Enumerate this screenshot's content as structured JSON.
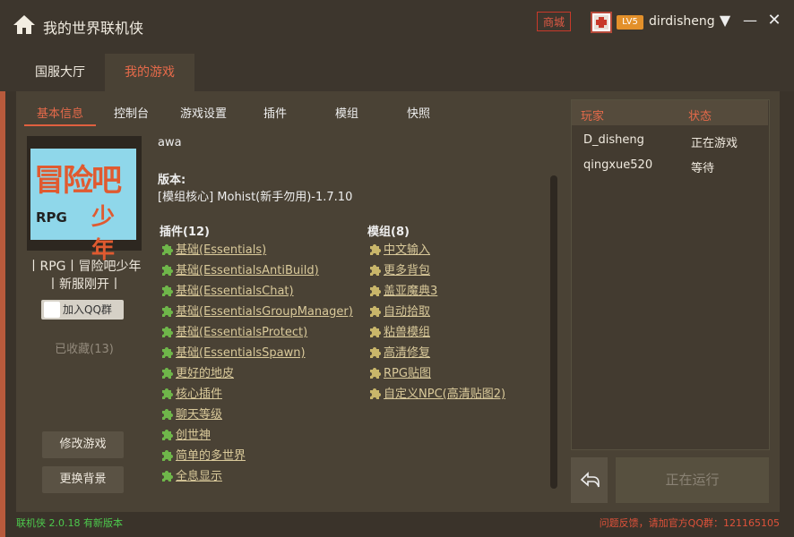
{
  "window": {
    "title": "我的世界联机侠",
    "shop": "商城",
    "level": "LV5",
    "username": "dirdisheng"
  },
  "main_tabs": [
    {
      "label": "国服大厅"
    },
    {
      "label": "我的游戏"
    }
  ],
  "sub_tabs": [
    {
      "label": "基本信息"
    },
    {
      "label": "控制台"
    },
    {
      "label": "游戏设置"
    },
    {
      "label": "插件"
    },
    {
      "label": "模组"
    },
    {
      "label": "快照"
    }
  ],
  "server": {
    "logo_text": "冒险吧",
    "logo_sub": "少年",
    "logo_rpg": "RPG",
    "description": "丨RPG丨冒险吧少年丨新服刚开丨",
    "qq_button": "加入QQ群",
    "favorites": "已收藏(13)",
    "modify_button": "修改游戏",
    "bg_button": "更换背景"
  },
  "info": {
    "desc": "awa",
    "version_label": "版本:",
    "version_value": "[模组核心] Mohist(新手勿用)-1.7.10"
  },
  "plugins": {
    "header": "插件(12)",
    "items": [
      "基础(Essentials)",
      "基础(EssentialsAntiBuild)",
      "基础(EssentialsChat)",
      "基础(EssentialsGroupManager)",
      "基础(EssentialsProtect)",
      "基础(EssentialsSpawn)",
      "更好的地皮",
      "核心插件",
      "聊天等级",
      "创世神",
      "简单的多世界",
      "全息显示"
    ]
  },
  "mods": {
    "header": "模组(8)",
    "items": [
      "中文输入",
      "更多背包",
      "盖亚魔典3",
      "自动拾取",
      "粘兽模组",
      "高清修复",
      "RPG贴图",
      "自定义NPC(高清贴图2)"
    ]
  },
  "players": {
    "col_player": "玩家",
    "col_status": "状态",
    "rows": [
      {
        "name": "D_disheng",
        "status": "正在游戏"
      },
      {
        "name": "qingxue520",
        "status": "等待"
      }
    ]
  },
  "actions": {
    "run": "正在运行"
  },
  "footer": {
    "version": "联机侠 2.0.18 有新版本",
    "feedback": "问题反馈，请加官方QQ群：121165105"
  },
  "colors": {
    "accent": "#e66a4a",
    "link": "#d9c99a",
    "puzzle": "#6fb64a",
    "puzzle_mod": "#c9b66a"
  }
}
